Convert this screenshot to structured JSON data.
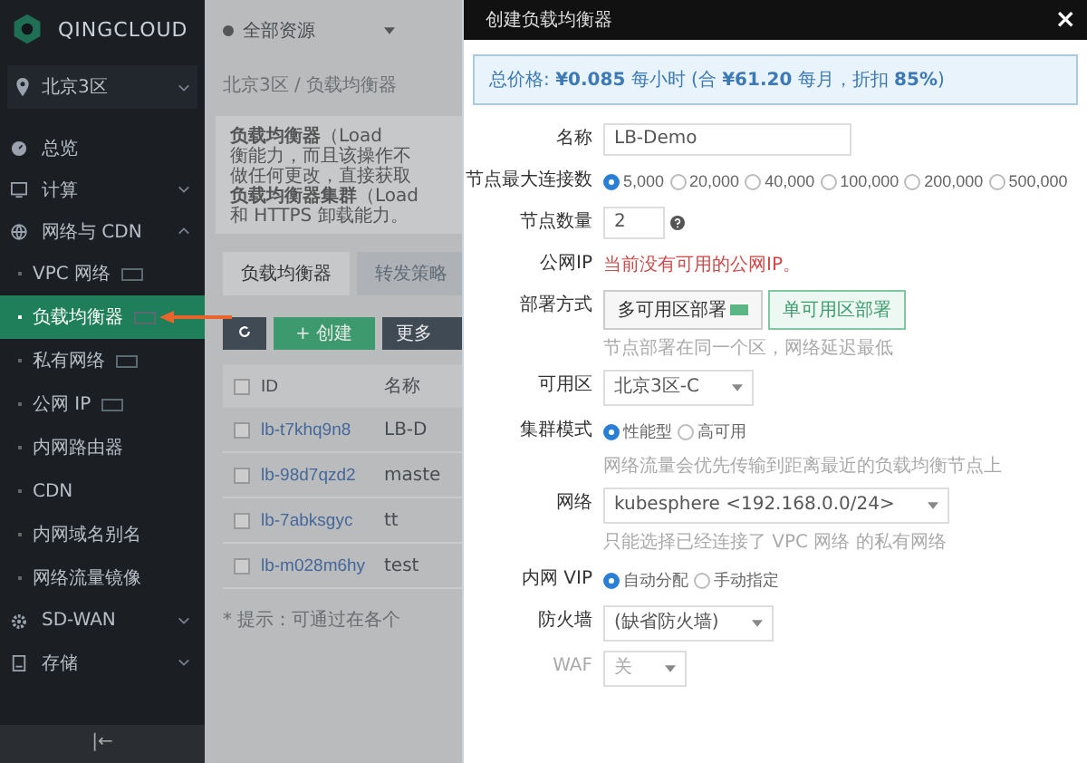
{
  "sidebar": {
    "brand": "QINGCLOUD",
    "region": "北京3区",
    "items": [
      {
        "label": "总览"
      },
      {
        "label": "计算",
        "expanded": false
      },
      {
        "label": "网络与 CDN",
        "expanded": true,
        "children": [
          {
            "label": "VPC 网络",
            "selected": false,
            "badge": true
          },
          {
            "label": "负载均衡器",
            "selected": true,
            "badge": true
          },
          {
            "label": "私有网络",
            "selected": false,
            "badge": true
          },
          {
            "label": "公网 IP",
            "selected": false,
            "badge": true
          },
          {
            "label": "内网路由器",
            "selected": false,
            "badge": false
          },
          {
            "label": "CDN",
            "selected": false,
            "badge": false
          },
          {
            "label": "内网域名别名",
            "selected": false,
            "badge": false
          },
          {
            "label": "网络流量镜像",
            "selected": false,
            "badge": false
          }
        ]
      },
      {
        "label": "SD-WAN",
        "expanded": false
      },
      {
        "label": "存储",
        "expanded": false
      }
    ],
    "collapse": "|←"
  },
  "background_page": {
    "scope": "全部资源",
    "breadcrumb": "北京3区 / 负载均衡器",
    "description": [
      "**负载均衡器**（Load",
      "衡能力，而且该操作不",
      "做任何更改，直接获取",
      "**负载均衡器集群**（Load",
      "和 HTTPS 卸载能力。"
    ],
    "tabs": [
      {
        "label": "负载均衡器",
        "selected": true
      },
      {
        "label": "转发策略",
        "selected": false
      }
    ],
    "create_button": "+ 创建",
    "more_button": "更多",
    "table": {
      "columns": [
        "ID",
        "名称"
      ],
      "all_checked": false,
      "rows": [
        {
          "id": "lb-t7khq9n8",
          "name": "LB-D",
          "checked": false
        },
        {
          "id": "lb-98d7qzd2",
          "name": "maste",
          "checked": false
        },
        {
          "id": "lb-7abksgyc",
          "name": "tt",
          "checked": false
        },
        {
          "id": "lb-m028m6hy",
          "name": "test",
          "checked": false
        }
      ]
    },
    "tip": "* 提示：可通过在各个"
  },
  "dialog": {
    "title": "创建负载均衡器",
    "close": "×",
    "price": "总价格: **¥0.085** 每小时 (合 **¥61.20** 每月，折扣 **85%**)",
    "fields": [
      {
        "kind": "text",
        "label": "名称",
        "value": "LB-Demo"
      },
      {
        "kind": "radio",
        "label": "节点最大连接数",
        "options": [
          {
            "label": "5,000",
            "selected": true
          },
          {
            "label": "20,000",
            "selected": false
          },
          {
            "label": "40,000",
            "selected": false
          },
          {
            "label": "100,000",
            "selected": false
          },
          {
            "label": "200,000",
            "selected": false
          },
          {
            "label": "500,000",
            "selected": false
          }
        ]
      },
      {
        "kind": "number",
        "label": "节点数量",
        "value": "2"
      },
      {
        "kind": "error",
        "label": "公网IP",
        "value": "当前没有可用的公网IP。"
      },
      {
        "kind": "segmented",
        "label": "部署方式",
        "options": [
          {
            "label": "多可用区部署",
            "selected": false,
            "badge": true
          },
          {
            "label": "单可用区部署",
            "selected": true,
            "badge": false
          }
        ],
        "hint": "节点部署在同一个区，网络延迟最低"
      },
      {
        "kind": "select",
        "label": "可用区",
        "value": "北京3区-C",
        "disabled": false
      },
      {
        "kind": "radio",
        "label": "集群模式",
        "options": [
          {
            "label": "性能型",
            "selected": true
          },
          {
            "label": "高可用",
            "selected": false
          }
        ],
        "hint": "网络流量会优先传输到距离最近的负载均衡节点上"
      },
      {
        "kind": "select",
        "label": "网络",
        "value": "kubesphere <192.168.0.0/24>",
        "disabled": false,
        "hint": "只能选择已经连接了 VPC 网络 的私有网络"
      },
      {
        "kind": "radio",
        "label": "内网 VIP",
        "options": [
          {
            "label": "自动分配",
            "selected": true
          },
          {
            "label": "手动指定",
            "selected": false
          }
        ]
      },
      {
        "kind": "select",
        "label": "防火墙",
        "value": "(缺省防火墙)",
        "disabled": false
      },
      {
        "kind": "select",
        "label": "WAF",
        "value": "关",
        "disabled": true
      }
    ]
  }
}
